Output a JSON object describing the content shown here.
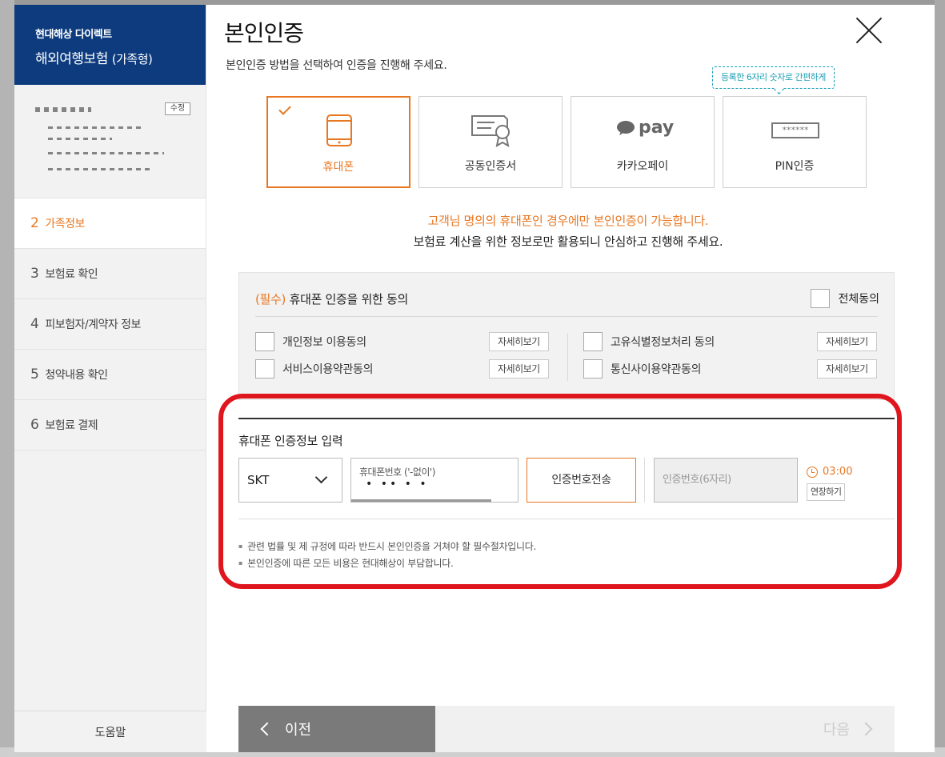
{
  "colors": {
    "brand": "#0d3b7e",
    "accent": "#e87722",
    "highlight": "#e0161e",
    "tooltip": "#1a9fb5"
  },
  "sidebar": {
    "brand_sub": "현대해상 다이렉트",
    "brand_title": "해외여행보험",
    "brand_kind": "(가족형)",
    "edit_label": "수정",
    "steps": [
      {
        "num": "2",
        "label": "가족정보"
      },
      {
        "num": "3",
        "label": "보험료 확인"
      },
      {
        "num": "4",
        "label": "피보험자/계약자 정보"
      },
      {
        "num": "5",
        "label": "청약내용 확인"
      },
      {
        "num": "6",
        "label": "보험료 결제"
      }
    ],
    "help_label": "도움말"
  },
  "header": {
    "title": "본인인증",
    "desc": "본인인증 방법을 선택하여 인증을 진행해 주세요."
  },
  "methods": [
    {
      "label": "휴대폰",
      "icon": "mobile-phone-icon"
    },
    {
      "label": "공동인증서",
      "icon": "certificate-icon"
    },
    {
      "label": "카카오페이",
      "icon": "kakaopay-icon",
      "logo_text": "pay"
    },
    {
      "label": "PIN인증",
      "icon": "pin-icon",
      "mask": "******"
    }
  ],
  "pin_tip": "등록한 6자리 숫자로 간편하게",
  "notice": {
    "line1": "고객님 명의의 휴대폰인 경우에만 본인인증이 가능합니다.",
    "line2": "보험료 계산을 위한 정보로만 활용되니 안심하고 진행해 주세요."
  },
  "agree": {
    "required_tag": "(필수)",
    "title": "휴대폰 인증을 위한 동의",
    "all_label": "전체동의",
    "detail_label": "자세히보기",
    "items": [
      "개인정보 이용동의",
      "서비스이용약관동의",
      "고유식별정보처리 동의",
      "통신사이용약관동의"
    ]
  },
  "phone": {
    "section_title": "휴대폰 인증정보 입력",
    "carrier": "SKT",
    "number_placeholder": "휴대폰번호 ('-없이')",
    "number_value": "• •• • •",
    "send_label": "인증번호전송",
    "code_placeholder": "인증번호(6자리)",
    "timer": "03:00",
    "extend_label": "연장하기"
  },
  "notes": [
    "관련 법률 및 제 규정에 따라 반드시 본인인증을 거쳐야 할 필수절차입니다.",
    "본인인증에 따른 모든 비용은 현대해상이 부담합니다."
  ],
  "footer": {
    "prev_label": "이전",
    "next_label": "다음"
  }
}
